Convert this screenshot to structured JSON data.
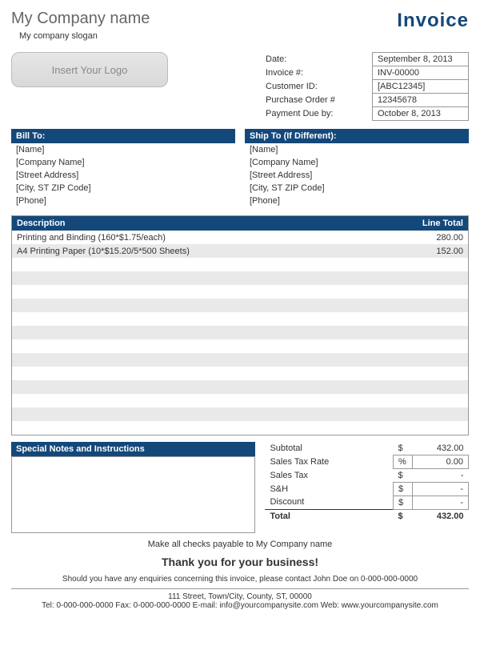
{
  "header": {
    "company_name": "My Company name",
    "company_slogan": "My company slogan",
    "invoice_title": "Invoice",
    "logo_placeholder": "Insert Your Logo"
  },
  "meta": {
    "labels": {
      "date": "Date:",
      "invoice_no": "Invoice #:",
      "customer_id": "Customer ID:",
      "po": "Purchase Order #",
      "due": "Payment Due by:"
    },
    "values": {
      "date": "September 8, 2013",
      "invoice_no": "INV-00000",
      "customer_id": "[ABC12345]",
      "po": "12345678",
      "due": "October 8, 2013"
    }
  },
  "bill_to": {
    "header": "Bill To:",
    "lines": [
      "[Name]",
      "[Company Name]",
      "[Street Address]",
      "[City, ST  ZIP Code]",
      "[Phone]"
    ]
  },
  "ship_to": {
    "header": "Ship To (If Different):",
    "lines": [
      "[Name]",
      "[Company Name]",
      "[Street Address]",
      "[City, ST  ZIP Code]",
      "[Phone]"
    ]
  },
  "items_header": {
    "desc": "Description",
    "total": "Line Total"
  },
  "items": [
    {
      "desc": "Printing and Binding (160*$1.75/each)",
      "total": "280.00"
    },
    {
      "desc": "A4 Printing Paper (10*$15.20/5*500 Sheets)",
      "total": "152.00"
    },
    {
      "desc": "",
      "total": ""
    },
    {
      "desc": "",
      "total": ""
    },
    {
      "desc": "",
      "total": ""
    },
    {
      "desc": "",
      "total": ""
    },
    {
      "desc": "",
      "total": ""
    },
    {
      "desc": "",
      "total": ""
    },
    {
      "desc": "",
      "total": ""
    },
    {
      "desc": "",
      "total": ""
    },
    {
      "desc": "",
      "total": ""
    },
    {
      "desc": "",
      "total": ""
    },
    {
      "desc": "",
      "total": ""
    },
    {
      "desc": "",
      "total": ""
    },
    {
      "desc": "",
      "total": ""
    }
  ],
  "notes_header": "Special Notes and Instructions",
  "totals": {
    "subtotal": {
      "label": "Subtotal",
      "cur": "$",
      "amt": "432.00"
    },
    "tax_rate": {
      "label": "Sales Tax Rate",
      "cur": "%",
      "amt": "0.00"
    },
    "sales_tax": {
      "label": "Sales Tax",
      "cur": "$",
      "amt": "-"
    },
    "sh": {
      "label": "S&H",
      "cur": "$",
      "amt": "-"
    },
    "discount": {
      "label": "Discount",
      "cur": "$",
      "amt": "-"
    },
    "total": {
      "label": "Total",
      "cur": "$",
      "amt": "432.00"
    }
  },
  "footer": {
    "payable": "Make all checks payable to My Company name",
    "thanks": "Thank you for your business!",
    "enquiry": "Should you have any enquiries concerning this invoice, please contact John Doe on 0-000-000-0000",
    "address": "111 Street, Town/City, County, ST, 00000",
    "contact": "Tel: 0-000-000-0000 Fax: 0-000-000-0000 E-mail: info@yourcompanysite.com Web: www.yourcompanysite.com"
  }
}
